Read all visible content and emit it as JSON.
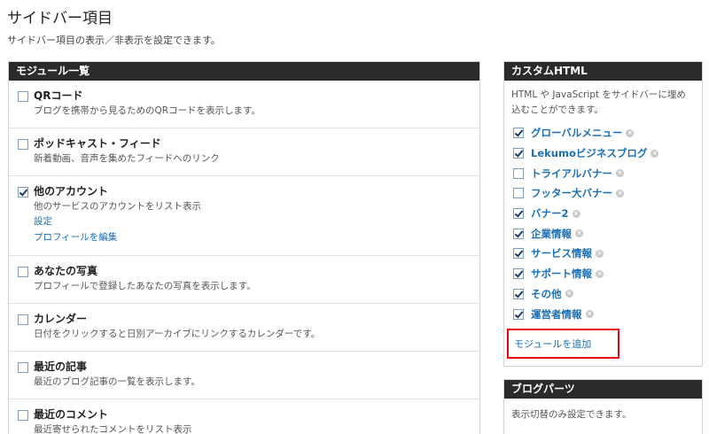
{
  "page": {
    "title": "サイドバー項目",
    "description": "サイドバー項目の表示／非表示を設定できます。"
  },
  "modules_panel": {
    "header": "モジュール一覧",
    "items": [
      {
        "title": "QRコード",
        "description": "ブログを携帯から見るためのQRコードを表示します。",
        "checked": false,
        "links": []
      },
      {
        "title": "ポッドキャスト・フィード",
        "description": "新着動画、音声を集めたフィードへのリンク",
        "checked": false,
        "links": []
      },
      {
        "title": "他のアカウント",
        "description": "他のサービスのアカウントをリスト表示",
        "checked": true,
        "links": [
          "設定",
          "プロフィールを編集"
        ]
      },
      {
        "title": "あなたの写真",
        "description": "プロフィールで登録したあなたの写真を表示します。",
        "checked": false,
        "links": []
      },
      {
        "title": "カレンダー",
        "description": "日付をクリックすると日別アーカイブにリンクするカレンダーです。",
        "checked": false,
        "links": []
      },
      {
        "title": "最近の記事",
        "description": "最近のブログ記事の一覧を表示します。",
        "checked": false,
        "links": []
      },
      {
        "title": "最近のコメント",
        "description": "最近寄せられたコメントをリスト表示",
        "checked": false,
        "links": []
      }
    ]
  },
  "custom_html_panel": {
    "header": "カスタムHTML",
    "description": "HTML や JavaScript をサイドバーに埋め込むことができます。",
    "items": [
      {
        "label": "グローバルメニュー",
        "checked": true
      },
      {
        "label": "Lekumoビジネスブログ",
        "checked": true
      },
      {
        "label": "トライアルバナー",
        "checked": false
      },
      {
        "label": "フッター大バナー",
        "checked": false
      },
      {
        "label": "バナー2",
        "checked": true
      },
      {
        "label": "企業情報",
        "checked": true
      },
      {
        "label": "サービス情報",
        "checked": true
      },
      {
        "label": "サポート情報",
        "checked": true
      },
      {
        "label": "その他",
        "checked": true
      },
      {
        "label": "運営者情報",
        "checked": true
      }
    ],
    "add_module_label": "モジュールを追加",
    "remove_icon_glyph": "×"
  },
  "blog_parts_panel": {
    "header": "ブログパーツ",
    "description": "表示切替のみ設定できます。"
  },
  "colors": {
    "header_bg": "#2b2b2b",
    "link": "#1a6fb5",
    "highlight_box": "#e8000f"
  }
}
